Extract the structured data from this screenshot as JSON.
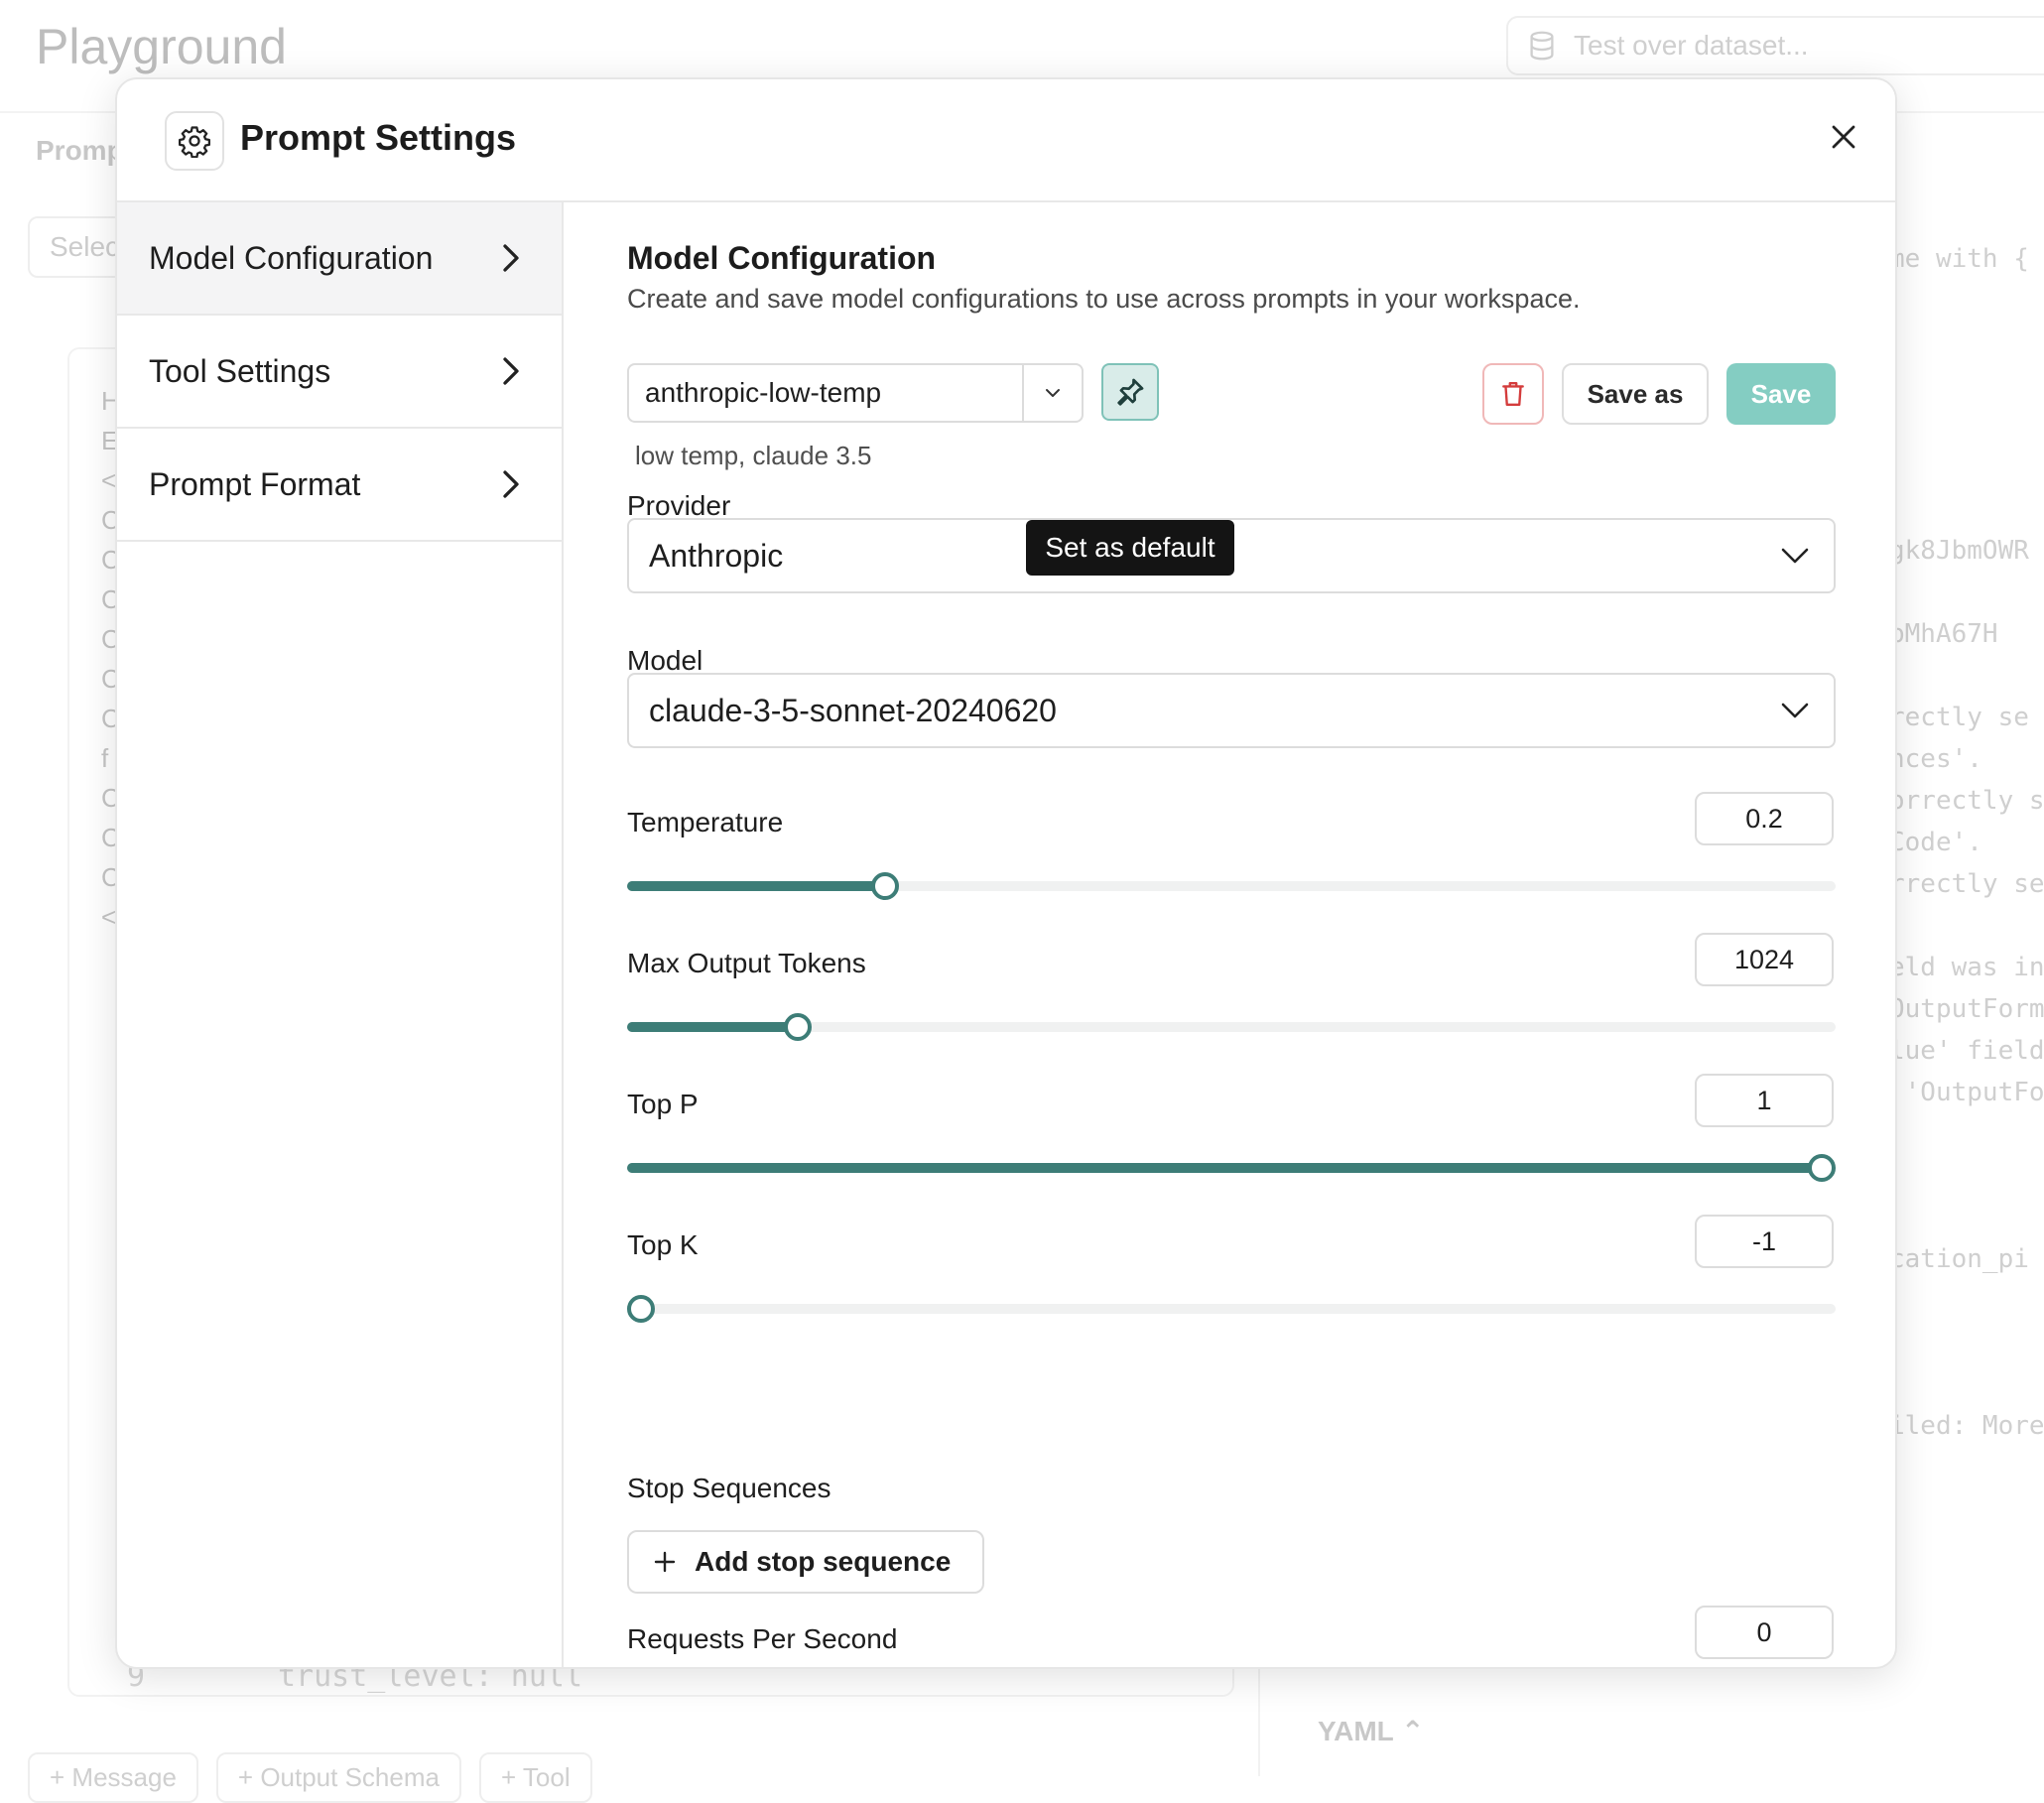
{
  "background": {
    "title": "Playground",
    "search_placeholder": "Test over dataset...",
    "prompt_tab": "Promp",
    "select_placeholder": "Selec",
    "col_letters": [
      "H",
      "E",
      "<",
      "C",
      "C",
      "C",
      "C",
      "C",
      "C",
      "f",
      "C",
      "C",
      "C",
      "<"
    ],
    "code_lines": [
      "me with { ar",
      "",
      "",
      "",
      "",
      "",
      "",
      "gk8JbmOWR",
      "",
      "bMhA67H",
      "",
      "rectly se",
      "nces'.",
      "orrectly s",
      "Code'.",
      "rrectly se",
      "",
      "eld was in",
      "OutputForm",
      "lue' field",
      " 'OutputFo",
      "",
      "",
      "",
      "cation_pi",
      "",
      "",
      "",
      "iled: More"
    ],
    "line_number": "9",
    "bottom_code": "trust_level: null",
    "yaml_label": "YAML",
    "bottom_tabs": [
      "+ Message",
      "+ Output Schema",
      "+ Tool"
    ]
  },
  "modal": {
    "title": "Prompt Settings",
    "icons": {
      "header": "gear-icon",
      "close": "close-icon"
    }
  },
  "sidebar": {
    "items": [
      {
        "label": "Model Configuration",
        "active": true
      },
      {
        "label": "Tool Settings",
        "active": false
      },
      {
        "label": "Prompt Format",
        "active": false
      }
    ]
  },
  "content": {
    "title": "Model Configuration",
    "description": "Create and save model configurations to use across prompts in your workspace.",
    "config": {
      "selected": "anthropic-low-temp",
      "description": "low temp, claude 3.5",
      "tooltip": "Set as default",
      "save_as_label": "Save as",
      "save_label": "Save"
    },
    "provider": {
      "label": "Provider",
      "value": "Anthropic"
    },
    "model": {
      "label": "Model",
      "value": "claude-3-5-sonnet-20240620"
    },
    "sliders": [
      {
        "label": "Temperature",
        "value": "0.2",
        "fraction": 0.207
      },
      {
        "label": "Max Output Tokens",
        "value": "1024",
        "fraction": 0.133
      },
      {
        "label": "Top P",
        "value": "1",
        "fraction": 1.0
      },
      {
        "label": "Top K",
        "value": "-1",
        "fraction": 0.0
      }
    ],
    "stop_sequences": {
      "label": "Stop Sequences",
      "add_label": "Add stop sequence"
    },
    "rps": {
      "label": "Requests Per Second",
      "value": "0",
      "fraction": 0.0
    }
  },
  "colors": {
    "accent": "#3d7d77",
    "save_button": "#84cdc2",
    "pin_bg": "#d9ece9",
    "delete": "#d43c3c",
    "tooltip_bg": "#141414"
  }
}
